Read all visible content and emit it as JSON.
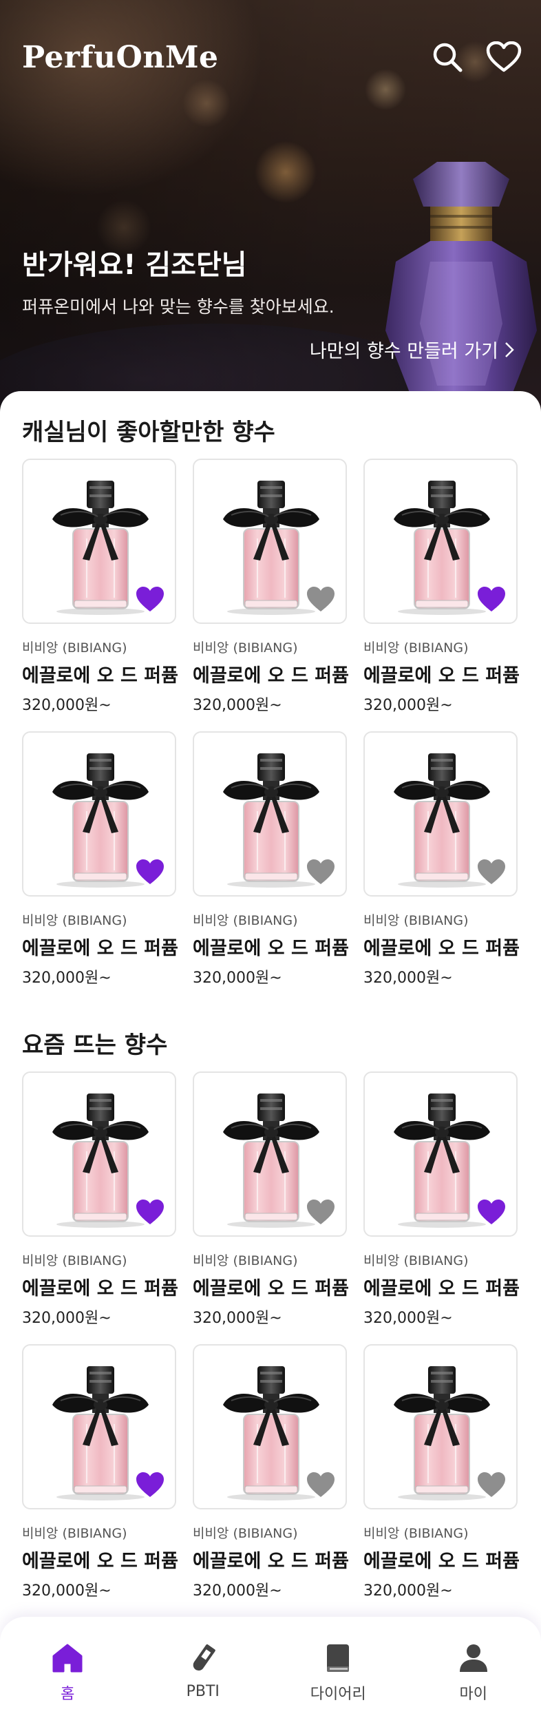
{
  "app": {
    "logo": "PerfuOnMe",
    "accent_color": "#7a1ed8",
    "inactive_heart_color": "#8e8e8e"
  },
  "header": {
    "icons": [
      "search-icon",
      "heart-outline-icon"
    ]
  },
  "hero": {
    "greeting": "반가워요! 김조단님",
    "subtext": "퍼퓨온미에서 나와 맞는 향수를 찾아보세요.",
    "cta": "나만의 향수 만들러 가기"
  },
  "sections": [
    {
      "title": "캐실님이 좋아할만한 향수",
      "products": [
        {
          "brand": "비비앙 (BIBIANG)",
          "name": "에끌로에 오 드 퍼퓸",
          "price": "320,000원~",
          "liked": true
        },
        {
          "brand": "비비앙 (BIBIANG)",
          "name": "에끌로에 오 드 퍼퓸",
          "price": "320,000원~",
          "liked": false
        },
        {
          "brand": "비비앙 (BIBIANG)",
          "name": "에끌로에 오 드 퍼퓸",
          "price": "320,000원~",
          "liked": true
        },
        {
          "brand": "비비앙 (BIBIANG)",
          "name": "에끌로에 오 드 퍼퓸",
          "price": "320,000원~",
          "liked": true
        },
        {
          "brand": "비비앙 (BIBIANG)",
          "name": "에끌로에 오 드 퍼퓸",
          "price": "320,000원~",
          "liked": false
        },
        {
          "brand": "비비앙 (BIBIANG)",
          "name": "에끌로에 오 드 퍼퓸",
          "price": "320,000원~",
          "liked": false
        }
      ]
    },
    {
      "title": "요즘 뜨는 향수",
      "products": [
        {
          "brand": "비비앙 (BIBIANG)",
          "name": "에끌로에 오 드 퍼퓸",
          "price": "320,000원~",
          "liked": true
        },
        {
          "brand": "비비앙 (BIBIANG)",
          "name": "에끌로에 오 드 퍼퓸",
          "price": "320,000원~",
          "liked": false
        },
        {
          "brand": "비비앙 (BIBIANG)",
          "name": "에끌로에 오 드 퍼퓸",
          "price": "320,000원~",
          "liked": true
        },
        {
          "brand": "비비앙 (BIBIANG)",
          "name": "에끌로에 오 드 퍼퓸",
          "price": "320,000원~",
          "liked": true
        },
        {
          "brand": "비비앙 (BIBIANG)",
          "name": "에끌로에 오 드 퍼퓸",
          "price": "320,000원~",
          "liked": false
        },
        {
          "brand": "비비앙 (BIBIANG)",
          "name": "에끌로에 오 드 퍼퓸",
          "price": "320,000원~",
          "liked": false
        }
      ]
    }
  ],
  "bottom_nav": [
    {
      "label": "홈",
      "icon": "home-icon",
      "active": true
    },
    {
      "label": "PBTI",
      "icon": "test-tube-icon",
      "active": false
    },
    {
      "label": "다이어리",
      "icon": "book-icon",
      "active": false
    },
    {
      "label": "마이",
      "icon": "person-icon",
      "active": false
    }
  ]
}
